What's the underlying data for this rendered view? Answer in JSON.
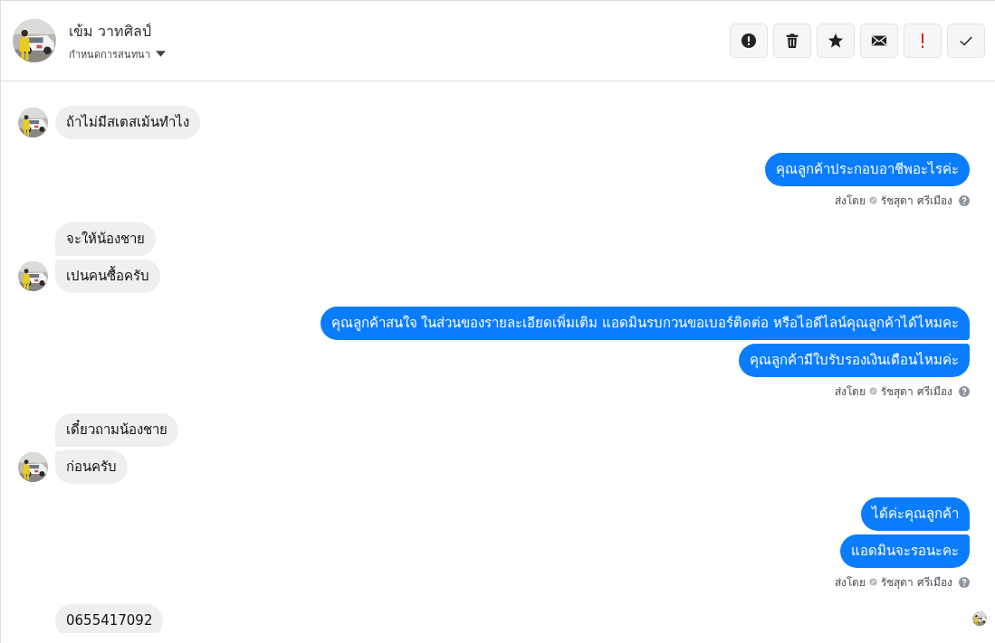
{
  "contact": {
    "name": "เข้ม วาทศิลป์",
    "subtitle": "กำหนดการสนทนา"
  },
  "toolbar": [
    {
      "kind": "alert"
    },
    {
      "kind": "delete"
    },
    {
      "kind": "star"
    },
    {
      "kind": "mail"
    },
    {
      "kind": "spam"
    },
    {
      "kind": "done"
    }
  ],
  "groups": [
    {
      "kind": "in",
      "messages": [
        "ถ้าไม่มีสเตสเม้นทำไง"
      ]
    },
    {
      "kind": "out",
      "messages": [
        "คุณลูกค้าประกอบอาชีพอะไรค่ะ"
      ],
      "sent_by": {
        "label": "ส่งโดย",
        "agent": "รัชสุดา ศรีเมือง"
      }
    },
    {
      "kind": "in",
      "messages": [
        "จะให้น้องชาย",
        "เปนคนซื้อครับ"
      ]
    },
    {
      "kind": "out",
      "messages": [
        "คุณลูกค้าสนใจ ในส่วนของรายละเอียดเพิ่มเติม แอดมินรบกวนขอเบอร์ติดต่อ หรือไอดีไลน์คุณลูกค้าได้ไหมคะ",
        "คุณลูกค้ามีใบรับรองเงินเดือนไหมค่ะ"
      ],
      "sent_by": {
        "label": "ส่งโดย",
        "agent": "รัชสุดา ศรีเมือง"
      }
    },
    {
      "kind": "in",
      "messages": [
        "เดี๋ยวถามน้องชาย",
        "ก่อนครับ"
      ]
    },
    {
      "kind": "out",
      "messages": [
        "ได้ค่ะคุณลูกค้า",
        "แอดมินจะรอนะคะ"
      ],
      "sent_by": {
        "label": "ส่งโดย",
        "agent": "รัชสุดา ศรีเมือง"
      }
    },
    {
      "kind": "in",
      "avatar": false,
      "messages": [
        "0655417092"
      ]
    }
  ],
  "seen": true
}
